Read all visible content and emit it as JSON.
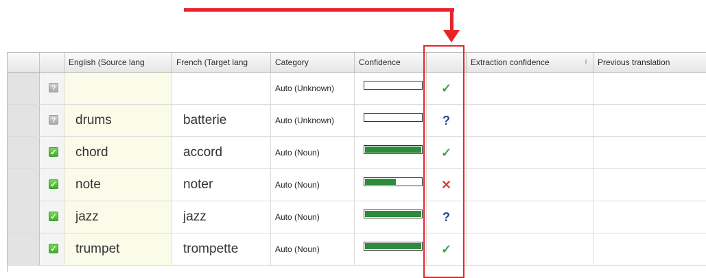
{
  "columns": {
    "source": "English (Source lang",
    "target": "French (Target lang",
    "category": "Category",
    "confidence": "Confidence",
    "mark": "",
    "extraction": "Extraction confidence",
    "previous": "Previous translation"
  },
  "rows": [
    {
      "status": "unknown",
      "status_glyph": "?",
      "source": "",
      "target": "",
      "category": "Auto (Unknown)",
      "confidence": 0.0,
      "mark": "check",
      "mark_glyph": "✓"
    },
    {
      "status": "unknown",
      "status_glyph": "?",
      "source": "drums",
      "target": "batterie",
      "category": "Auto (Unknown)",
      "confidence": 0.0,
      "mark": "question",
      "mark_glyph": "?"
    },
    {
      "status": "ok",
      "status_glyph": "✓",
      "source": "chord",
      "target": "accord",
      "category": "Auto (Noun)",
      "confidence": 1.0,
      "mark": "check",
      "mark_glyph": "✓"
    },
    {
      "status": "ok",
      "status_glyph": "✓",
      "source": "note",
      "target": "noter",
      "category": "Auto (Noun)",
      "confidence": 0.55,
      "mark": "cross",
      "mark_glyph": "✕"
    },
    {
      "status": "ok",
      "status_glyph": "✓",
      "source": "jazz",
      "target": "jazz",
      "category": "Auto (Noun)",
      "confidence": 1.0,
      "mark": "question",
      "mark_glyph": "?"
    },
    {
      "status": "ok",
      "status_glyph": "✓",
      "source": "trumpet",
      "target": "trompette",
      "category": "Auto (Noun)",
      "confidence": 1.0,
      "mark": "check",
      "mark_glyph": "✓"
    }
  ],
  "colors": {
    "annotation": "#e8232a",
    "bar_fill": "#2d8c3c",
    "check": "#3aa548",
    "question": "#1f4a8f",
    "cross": "#e03a2f"
  }
}
